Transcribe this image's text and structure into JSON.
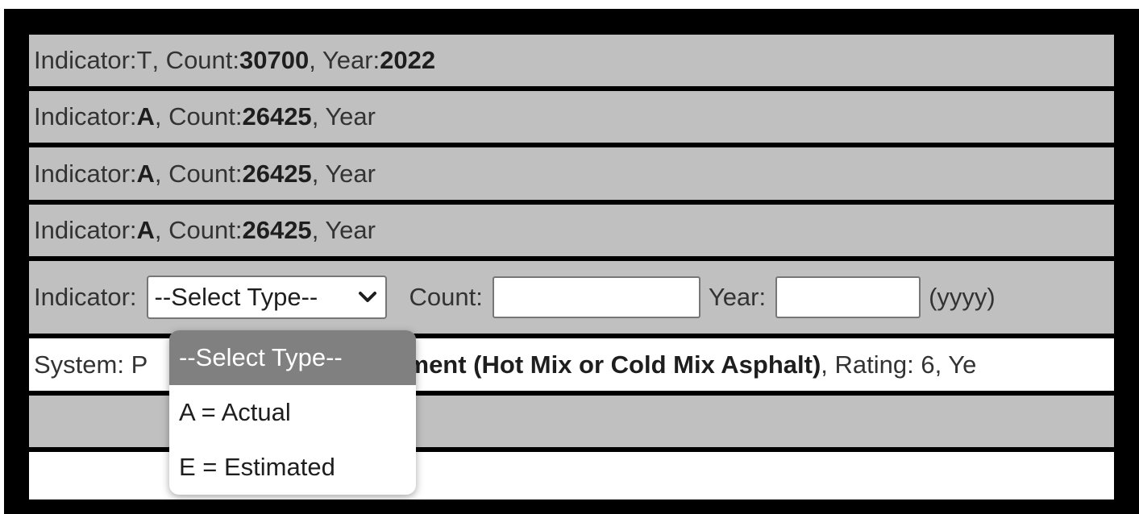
{
  "rows": [
    {
      "indicator_label": "Indicator: ",
      "indicator": "T",
      "count_label": ", Count: ",
      "count": "30700",
      "year_label": ", Year: ",
      "year": "2022"
    },
    {
      "indicator_label": "Indicator: ",
      "indicator": "A",
      "count_label": ", Count: ",
      "count": "26425",
      "year_label": ", Year",
      "year": ""
    },
    {
      "indicator_label": "Indicator: ",
      "indicator": "A",
      "count_label": ", Count: ",
      "count": "26425",
      "year_label": ", Year",
      "year": ""
    },
    {
      "indicator_label": "Indicator: ",
      "indicator": "A",
      "count_label": ", Count: ",
      "count": "26425",
      "year_label": ", Year",
      "year": ""
    }
  ],
  "form": {
    "indicator_label": "Indicator:",
    "select_value": "--Select Type--",
    "count_label": "Count:",
    "count_value": "",
    "year_label": "Year:",
    "year_value": "",
    "year_hint": "(yyyy)"
  },
  "system_row": {
    "prefix": "System: P",
    "system_name": "ement (Hot Mix or Cold Mix Asphalt)",
    "suffix": ", Rating: 6, Ye"
  },
  "dropdown": {
    "options": [
      "--Select Type--",
      "A = Actual",
      "E = Estimated"
    ],
    "selected_index": 0
  },
  "colors": {
    "frame": "#000000",
    "row_gray": "#c0c0c0",
    "row_white": "#ffffff",
    "option_selected": "#808080"
  }
}
